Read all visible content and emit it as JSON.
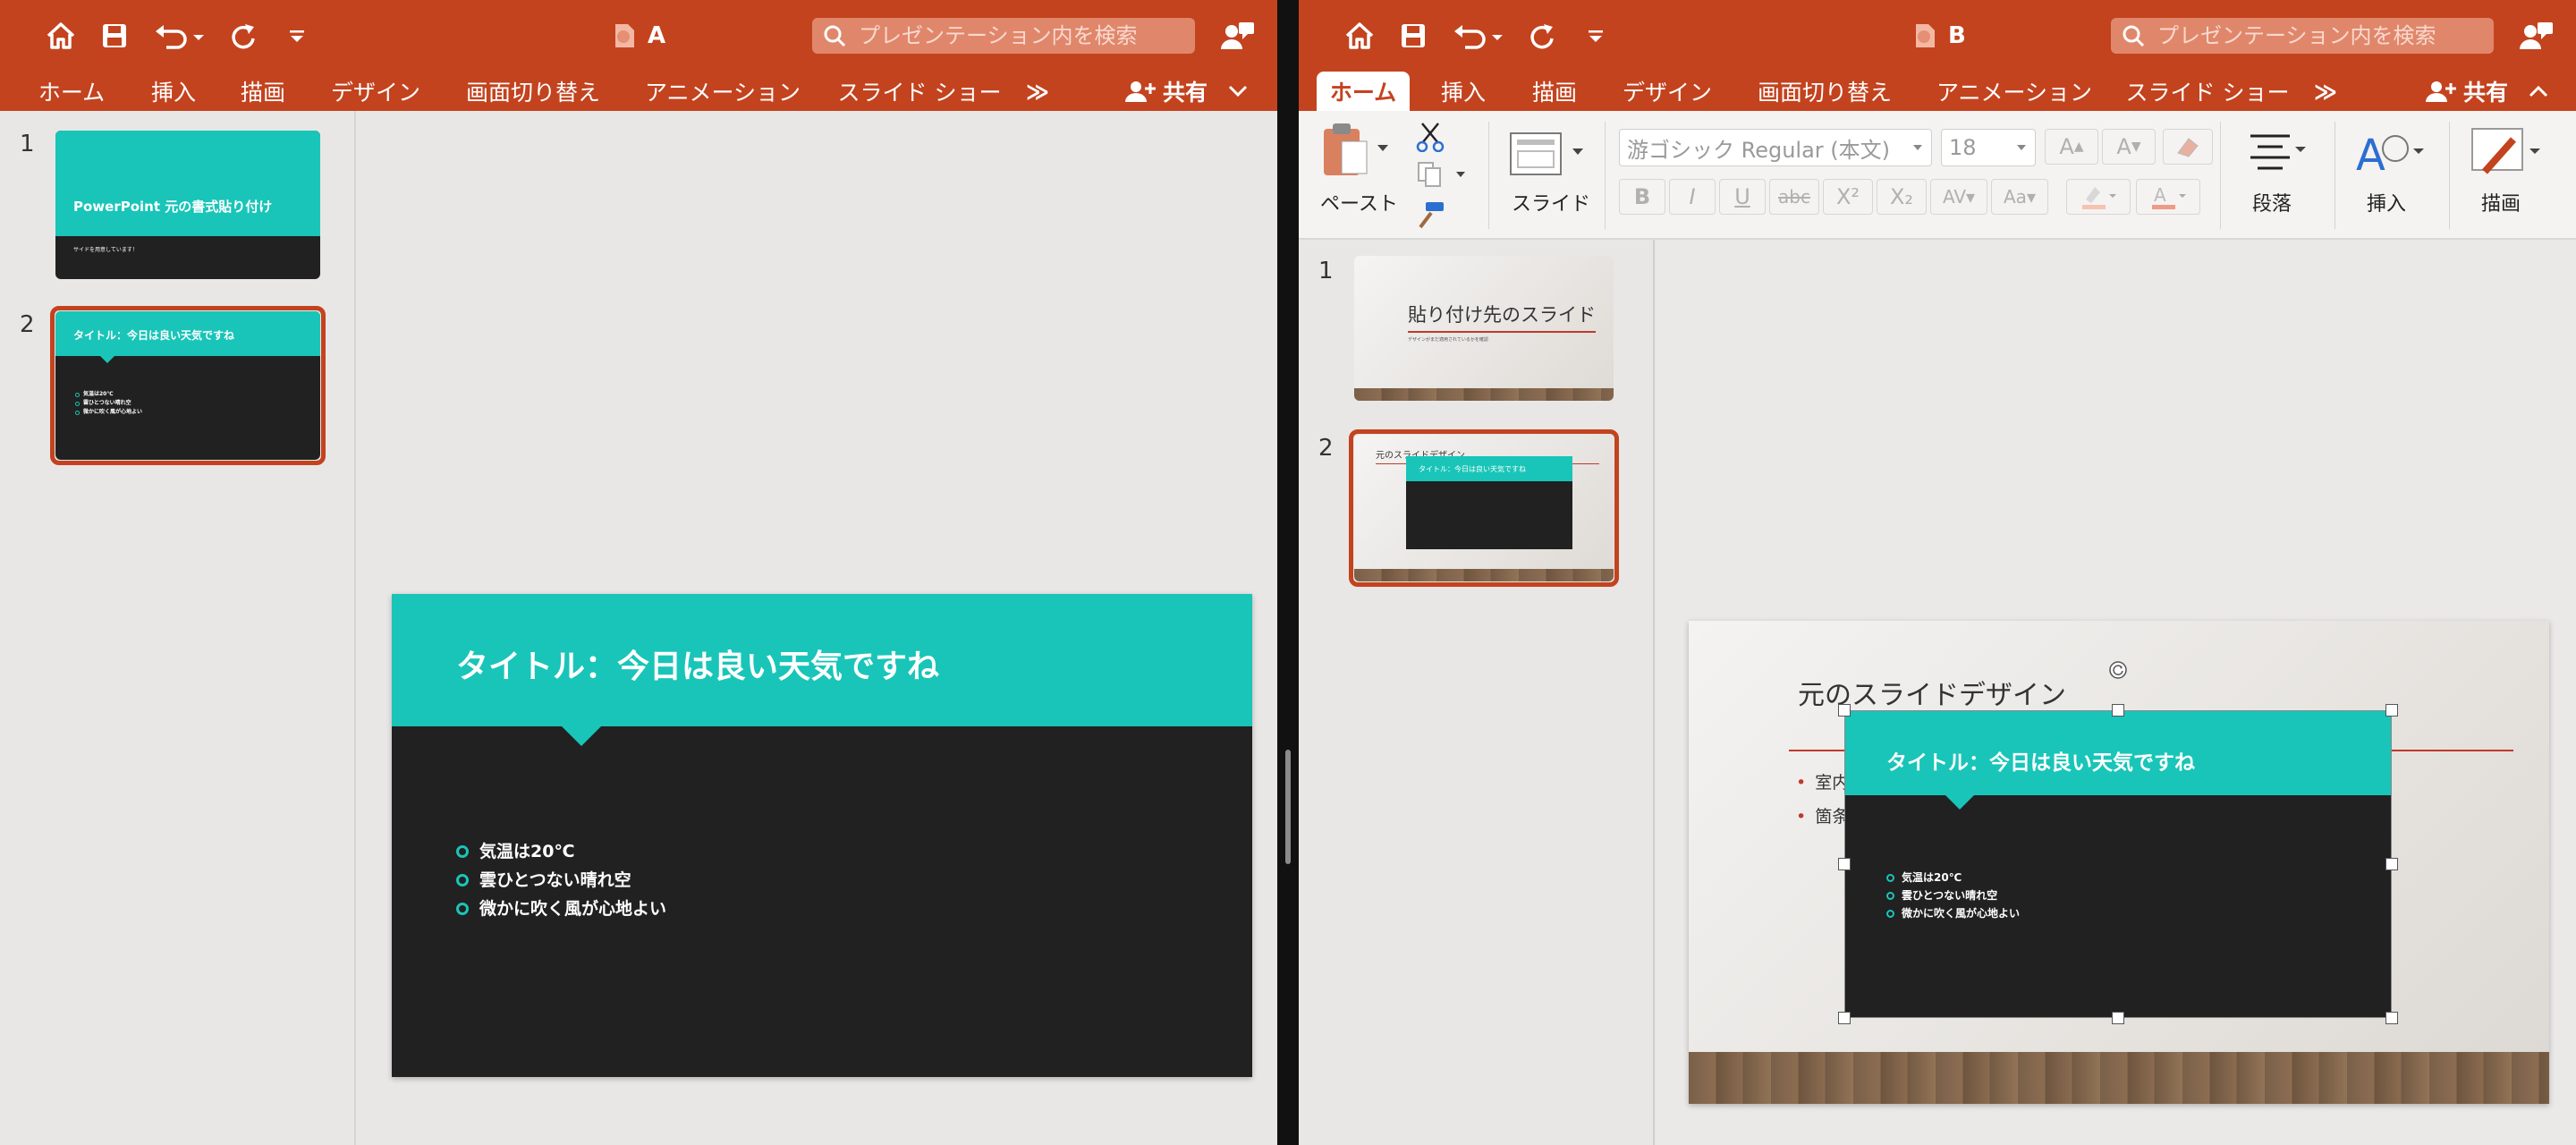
{
  "paneA": {
    "title": "A",
    "search_placeholder": "プレゼンテーション内を検索",
    "tabs": [
      "ホーム",
      "挿入",
      "描画",
      "デザイン",
      "画面切り替え",
      "アニメーション",
      "スライド ショー"
    ],
    "more": "≫",
    "share_label": "共有",
    "thumbs": {
      "num1": "1",
      "num2": "2",
      "t1_title": "PowerPoint 元の書式貼り付け",
      "t1_sub": "サイドを用意しています！",
      "t2_title": "タイトル：今日は良い天気ですね",
      "t2_bullets": [
        "気温は20℃",
        "雲ひとつない晴れ空",
        "微かに吹く風が心地よい"
      ]
    },
    "slide": {
      "title": "タイトル：今日は良い天気ですね",
      "bullets": [
        "気温は20℃",
        "雲ひとつない晴れ空",
        "微かに吹く風が心地よい"
      ]
    }
  },
  "paneB": {
    "title": "B",
    "search_placeholder": "プレゼンテーション内を検索",
    "tabs": [
      "ホーム",
      "挿入",
      "描画",
      "デザイン",
      "画面切り替え",
      "アニメーション",
      "スライド ショー"
    ],
    "more": "≫",
    "share_label": "共有",
    "ribbon": {
      "paste": "ペースト",
      "slide": "スライド",
      "font": "游ゴシック Regular (本文)",
      "size": "18",
      "bold": "B",
      "italic": "I",
      "underline": "U",
      "strike": "abc",
      "superscript": "X²",
      "subscript": "X₂",
      "paragraph": "段落",
      "insert": "挿入",
      "draw": "描画"
    },
    "thumbs": {
      "num1": "1",
      "num2": "2",
      "t1_title": "貼り付け先のスライド",
      "t1_sub": "デザインがまだ適用されているかを確認",
      "t2_title": "元のスライドデザイン",
      "t2_inner_title": "タイトル：今日は良い天気ですね"
    },
    "slide": {
      "title": "元のスライドデザイン",
      "bullets_visible": [
        "室内",
        "箇条"
      ],
      "pasted_title": "タイトル：今日は良い天気ですね",
      "pasted_bullets": [
        "気温は20℃",
        "雲ひとつない晴れ空",
        "微かに吹く風が心地よい"
      ]
    }
  },
  "colors": {
    "brand": "#c3431f",
    "teal": "#19c5b8",
    "slide_dark": "#212121",
    "accent_red": "#c0392b"
  }
}
